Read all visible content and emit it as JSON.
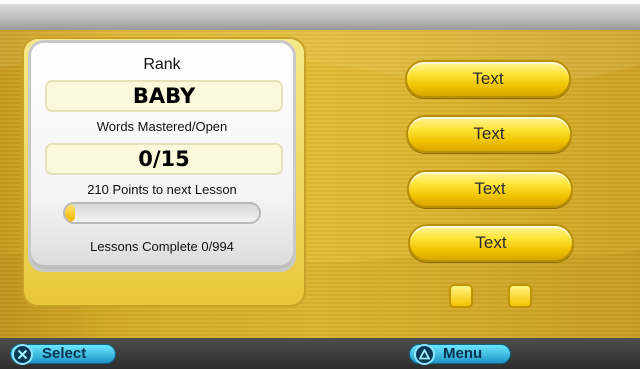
{
  "panel": {
    "rank_label": "Rank",
    "rank_value": "BABY",
    "words_label": "Words Mastered/Open",
    "words_value": "0/15",
    "points_label": "210 Points to next Lesson",
    "progress_fraction": 0.05,
    "lessons_label": "Lessons Complete 0/994"
  },
  "menu": {
    "buttons": [
      {
        "label": "Text"
      },
      {
        "label": "Text"
      },
      {
        "label": "Text"
      },
      {
        "label": "Text"
      }
    ]
  },
  "footer": {
    "select_label": "Select",
    "menu_label": "Menu",
    "select_icon": "cross-button-icon",
    "menu_icon": "triangle-button-icon"
  },
  "colors": {
    "background_gold": "#ddb42a",
    "button_yellow": "#ffe53a",
    "footer_blue": "#1d96c6"
  }
}
